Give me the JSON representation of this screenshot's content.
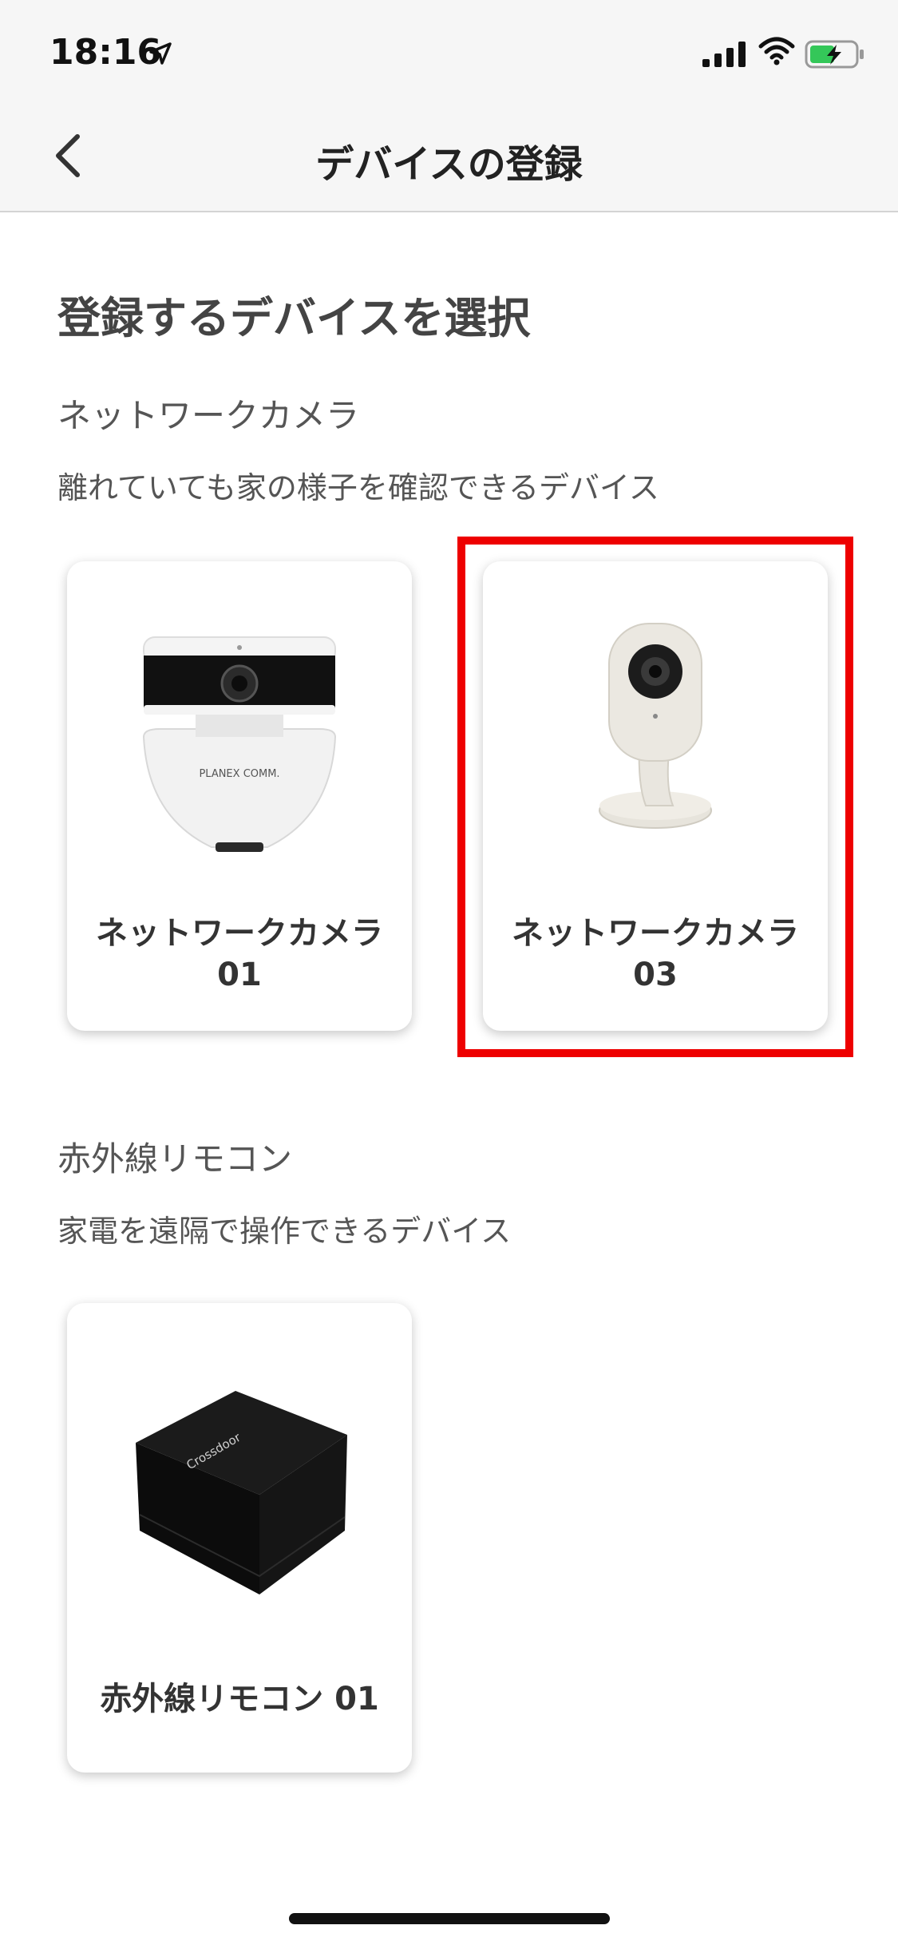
{
  "status_bar": {
    "time": "18:16"
  },
  "nav": {
    "title": "デバイスの登録"
  },
  "page": {
    "heading": "登録するデバイスを選択"
  },
  "sections": [
    {
      "title": "ネットワークカメラ",
      "description": "離れていても家の様子を確認できるデバイス",
      "devices": [
        {
          "name_line1": "ネットワークカメラ",
          "name_line2": "01",
          "brand": "PLANEX COMM."
        },
        {
          "name_line1": "ネットワークカメラ",
          "name_line2": "03"
        }
      ]
    },
    {
      "title": "赤外線リモコン",
      "description": "家電を遠隔で操作できるデバイス",
      "devices": [
        {
          "name": "赤外線リモコン 01",
          "brand": "Crossdoor"
        }
      ]
    }
  ],
  "colors": {
    "highlight": "#ee0000",
    "background": "#ffffff",
    "bar": "#f6f6f6"
  },
  "icons": [
    "location-arrow-icon",
    "signal-icon",
    "wifi-icon",
    "battery-charging-icon",
    "chevron-left-icon"
  ]
}
